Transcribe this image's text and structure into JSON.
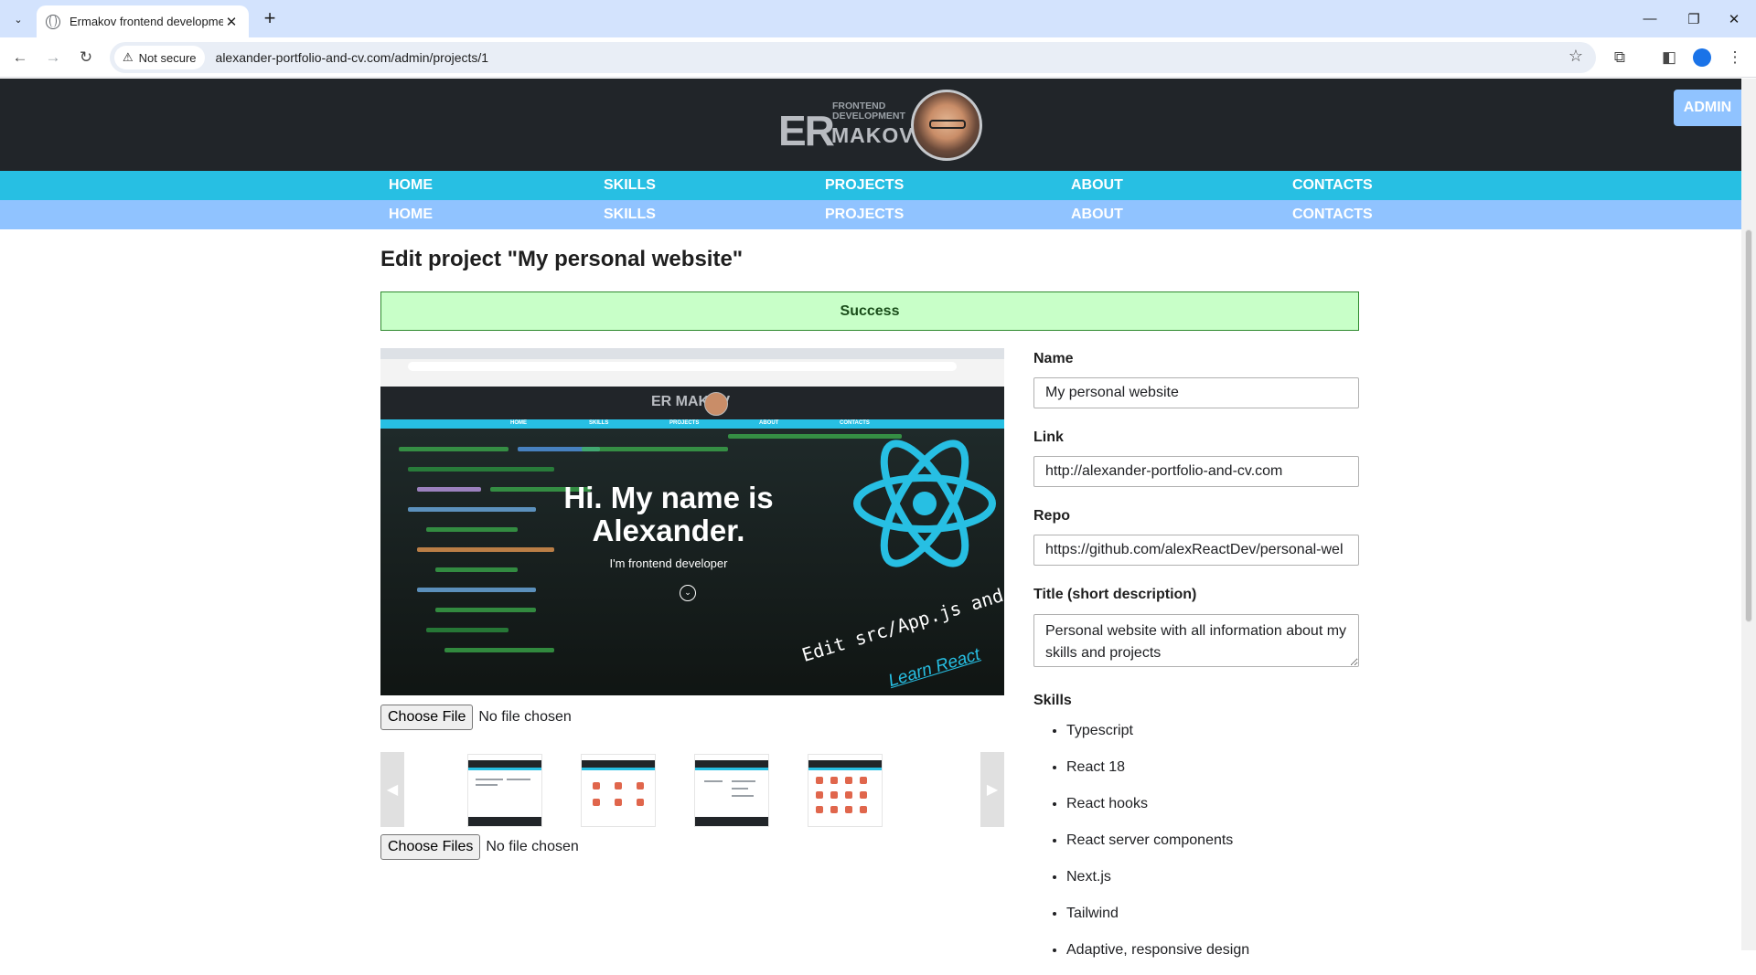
{
  "browser": {
    "tab_title": "Ermakov frontend development",
    "security_label": "Not secure",
    "url": "alexander-portfolio-and-cv.com/admin/projects/1"
  },
  "site": {
    "logo": {
      "small_text_1": "FRONTEND",
      "small_text_2": "DEVELOPMENT",
      "big_text": "MAKOV",
      "letters": "ER"
    },
    "admin_button": "ADMIN",
    "nav": [
      "HOME",
      "SKILLS",
      "PROJECTS",
      "ABOUT",
      "CONTACTS"
    ],
    "accent_color": "#27bfe3",
    "secondary_color": "#90c3ff"
  },
  "main": {
    "title": "Edit project \"My personal website\"",
    "success_message": "Success",
    "preview": {
      "greeting": "Hi. My name is Alexander.",
      "subtitle": "I'm frontend developer",
      "code_text": "Edit src/App.js and save to rel",
      "learn_link": "Learn React",
      "nav": [
        "HOME",
        "SKILLS",
        "PROJECTS",
        "ABOUT",
        "CONTACTS"
      ]
    },
    "main_image_input": {
      "button": "Choose File",
      "status": "No file chosen"
    },
    "gallery_input": {
      "button": "Choose Files",
      "status": "No file chosen"
    },
    "form": {
      "name_label": "Name",
      "name_value": "My personal website",
      "link_label": "Link",
      "link_value": "http://alexander-portfolio-and-cv.com",
      "repo_label": "Repo",
      "repo_value": "https://github.com/alexReactDev/personal-wel",
      "title_label": "Title (short description)",
      "title_value": "Personal website with all information about my skills and projects",
      "skills_label": "Skills",
      "skills": [
        "Typescript",
        "React 18",
        "React hooks",
        "React server components",
        "Next.js",
        "Tailwind",
        "Adaptive, responsive design"
      ]
    }
  }
}
